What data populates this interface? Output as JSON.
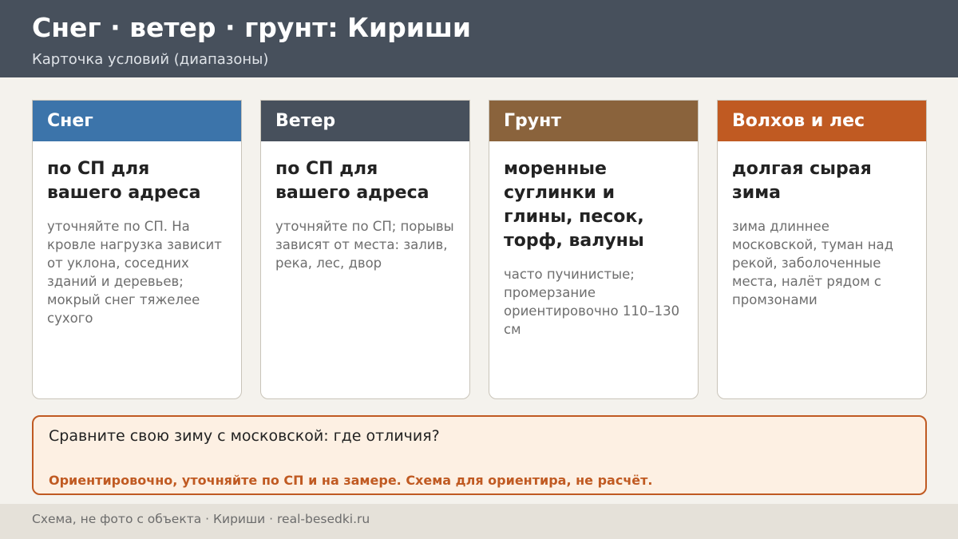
{
  "header": {
    "title": "Снег · ветер · грунт: Кириши",
    "subtitle": "Карточка условий (диапазоны)",
    "background_color": "#47505c"
  },
  "cards": [
    {
      "heading": "Снег",
      "color": "#3c74aa",
      "main": "по СП для вашего адреса",
      "note": "уточняйте по СП. На кровле нагрузка зависит от уклона, соседних зданий и деревьев; мокрый снег тяжелее сухого"
    },
    {
      "heading": "Ветер",
      "color": "#47505c",
      "main": "по СП для вашего адреса",
      "note": "уточняйте по СП; порывы зависят от места: залив, река, лес, двор"
    },
    {
      "heading": "Грунт",
      "color": "#8a633c",
      "main": "моренные суглинки и глины, песок, торф, валуны",
      "note": "часто пучинистые; промерзание ориентировочно 110–130 см"
    },
    {
      "heading": "Волхов и лес",
      "color": "#c05a22",
      "main": "долгая сырая зима",
      "note": "зима длиннее московской, туман над рекой, заболоченные места, налёт рядом с промзонами"
    }
  ],
  "callout": {
    "question": "Сравните свою зиму с московской: где отличия?",
    "warning": "Ориентировочно, уточняйте по СП и на замере. Схема для ориентира, не расчёт.",
    "accent_color": "#c05a22"
  },
  "footer": {
    "text": "Схема, не фото с объекта  ·  Кириши  ·  real-besedki.ru"
  }
}
